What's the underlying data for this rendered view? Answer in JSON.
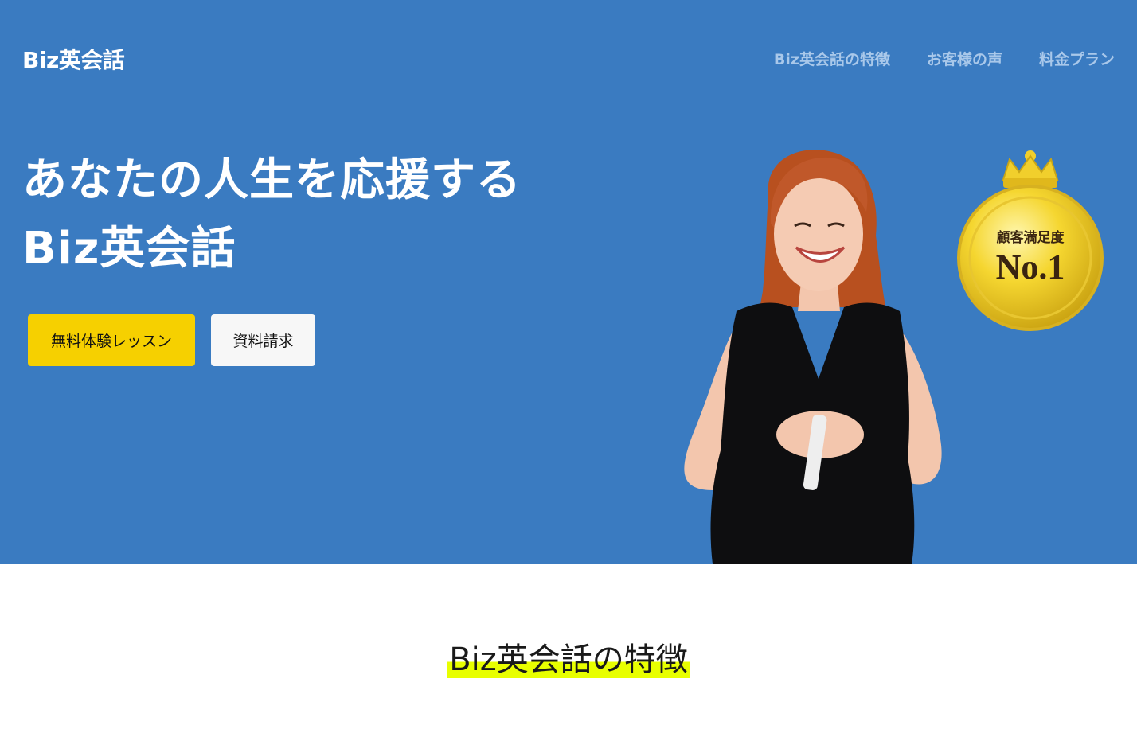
{
  "header": {
    "logo": "Biz英会話",
    "nav": [
      {
        "label": "Biz英会話の特徴"
      },
      {
        "label": "お客様の声"
      },
      {
        "label": "料金プラン"
      }
    ]
  },
  "hero": {
    "headline_line1": "あなたの人生を応援する",
    "headline_line2": "Biz英会話",
    "cta_trial": "無料体験レッスン",
    "cta_docs": "資料請求",
    "medal": {
      "line1": "顧客満足度",
      "line2": "No.1"
    }
  },
  "features": {
    "title": "Biz英会話の特徴"
  },
  "colors": {
    "hero_bg": "#3a7bc1",
    "cta_yellow": "#f6d000",
    "highlight": "#e8ff00"
  }
}
